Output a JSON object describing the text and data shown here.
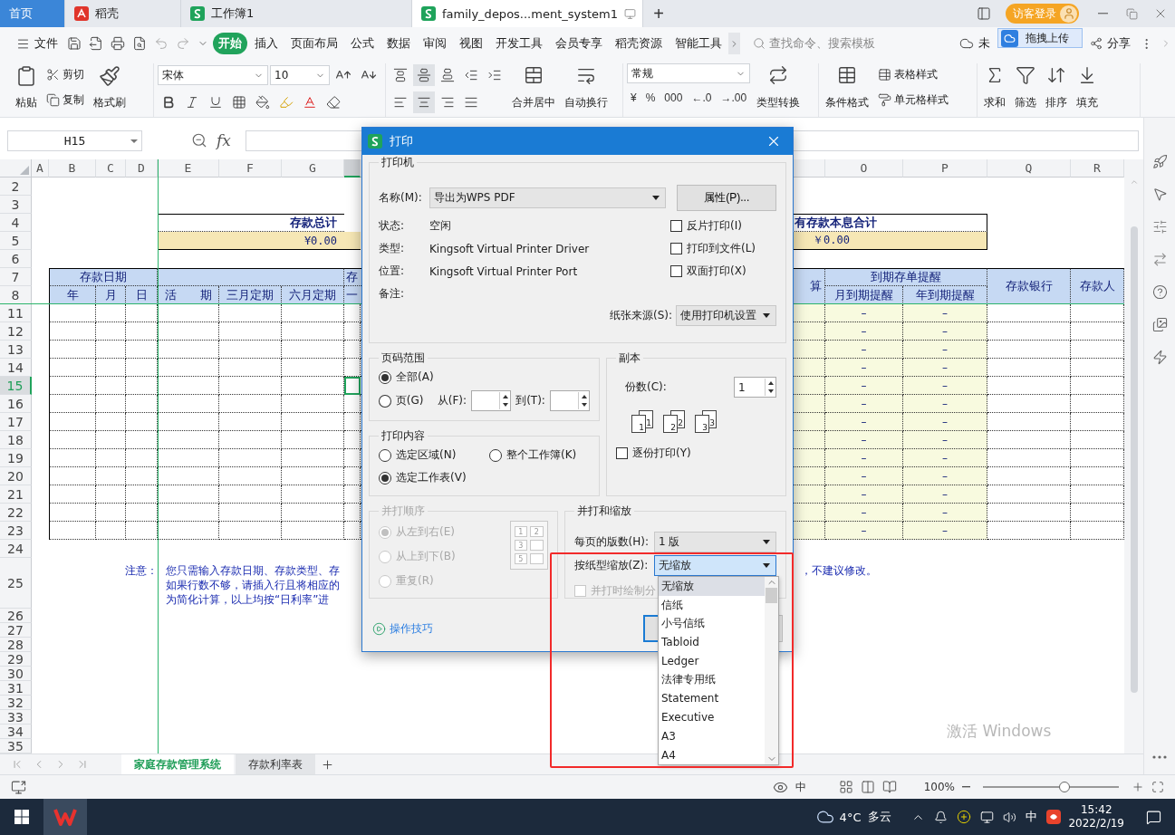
{
  "title_bar": {
    "tabs": [
      {
        "label": "首页",
        "selected": false,
        "kind": "home"
      },
      {
        "label": "稻壳",
        "selected": false,
        "kind": "docer"
      },
      {
        "label": "工作簿1",
        "selected": false,
        "kind": "sheet"
      },
      {
        "label": "family_depos...ment_system1",
        "selected": true,
        "kind": "sheet"
      }
    ],
    "new_tab": "+",
    "login": "访客登录"
  },
  "menu": {
    "file": "文件",
    "tabs": [
      {
        "label": "开始",
        "selected": true
      },
      {
        "label": "插入",
        "selected": false
      },
      {
        "label": "页面布局",
        "selected": false
      },
      {
        "label": "公式",
        "selected": false
      },
      {
        "label": "数据",
        "selected": false
      },
      {
        "label": "审阅",
        "selected": false
      },
      {
        "label": "视图",
        "selected": false
      },
      {
        "label": "开发工具",
        "selected": false
      },
      {
        "label": "会员专享",
        "selected": false
      },
      {
        "label": "稻壳资源",
        "selected": false
      },
      {
        "label": "智能工具",
        "selected": false
      }
    ],
    "search_placeholder": "查找命令、搜索模板",
    "sync": "未",
    "upload_tip": "拖拽上传",
    "share": "分享"
  },
  "ribbon": {
    "paste": "粘贴",
    "cut": "剪切",
    "copy": "复制",
    "painter": "格式刷",
    "font": "宋体",
    "size": "10",
    "merge": "合并居中",
    "wrap": "自动换行",
    "number_format": "常规",
    "number_buttons": [
      "¥",
      "%",
      "000",
      "←.0",
      "→.00"
    ],
    "convert": "类型转换",
    "conditional": "条件格式",
    "table_style": "表格样式",
    "cell_style": "单元格样式",
    "sum": "求和",
    "filter": "筛选",
    "sort": "排序",
    "fill": "填充"
  },
  "formula_bar": {
    "cell": "H15",
    "fx": "fx"
  },
  "sheet": {
    "columns": [
      {
        "label": "A",
        "selected": false
      },
      {
        "label": "B",
        "selected": false
      },
      {
        "label": "C",
        "selected": false
      },
      {
        "label": "D",
        "selected": false
      },
      {
        "label": "E",
        "selected": false
      },
      {
        "label": "F",
        "selected": false
      },
      {
        "label": "G",
        "selected": false
      },
      {
        "selected": true
      },
      {
        "selected": false
      },
      {
        "selected": false
      },
      {
        "label": "O",
        "selected": false
      },
      {
        "label": "P",
        "selected": false
      },
      {
        "label": "Q",
        "selected": false
      },
      {
        "label": "R",
        "selected": false
      }
    ],
    "row_headers": [
      {
        "label": "2",
        "selected": false
      },
      {
        "label": "3",
        "selected": false
      },
      {
        "label": "4",
        "selected": false
      },
      {
        "label": "5",
        "selected": false
      },
      {
        "label": "6",
        "selected": false
      },
      {
        "label": "7",
        "selected": false
      },
      {
        "label": "8",
        "selected": false
      },
      {
        "label": "11",
        "selected": false
      },
      {
        "label": "12",
        "selected": false
      },
      {
        "label": "13",
        "selected": false
      },
      {
        "label": "14",
        "selected": false
      },
      {
        "label": "15",
        "selected": true
      },
      {
        "label": "16",
        "selected": false
      },
      {
        "label": "17",
        "selected": false
      },
      {
        "label": "18",
        "selected": false
      },
      {
        "label": "19",
        "selected": false
      },
      {
        "label": "20",
        "selected": false
      },
      {
        "label": "21",
        "selected": false
      },
      {
        "label": "22",
        "selected": false
      },
      {
        "label": "23",
        "selected": false
      },
      {
        "label": "24",
        "selected": false
      },
      {
        "label": "25",
        "selected": false
      },
      {
        "label": "26",
        "selected": false
      },
      {
        "label": "27",
        "selected": false
      },
      {
        "label": "28",
        "selected": false
      },
      {
        "label": "29",
        "selected": false
      },
      {
        "label": "30",
        "selected": false
      },
      {
        "label": "31",
        "selected": false
      },
      {
        "label": "32",
        "selected": false
      },
      {
        "label": "33",
        "selected": false
      },
      {
        "label": "34",
        "selected": false
      },
      {
        "label": "35",
        "selected": false
      }
    ],
    "summary": [
      {
        "label": "存款总计",
        "value": "¥0.00"
      },
      {
        "label": "有存款本息合计",
        "value": "￥0.00"
      }
    ],
    "header": {
      "date_group": "存款日期",
      "date_cols": [
        "年",
        "月",
        "日"
      ],
      "type_cols": [
        "活　　期",
        "三月定期",
        "六月定期"
      ],
      "type_group_cut": "存",
      "type_cut": "一",
      "calc_cut": "算",
      "reminder_group": "到期存单提醒",
      "reminder_cols": [
        "月到期提醒",
        "年到期提醒"
      ],
      "bank": "存款银行",
      "depositor": "存款人"
    },
    "data_rows": [
      {
        "selected": false,
        "reminders": [
          "–",
          "–"
        ]
      },
      {
        "selected": false,
        "reminders": [
          "–",
          "–"
        ]
      },
      {
        "selected": false,
        "reminders": [
          "–",
          "–"
        ]
      },
      {
        "selected": false,
        "reminders": [
          "–",
          "–"
        ]
      },
      {
        "selected": true,
        "reminders": [
          "–",
          "–"
        ]
      },
      {
        "selected": false,
        "reminders": [
          "–",
          "–"
        ]
      },
      {
        "selected": false,
        "reminders": [
          "–",
          "–"
        ]
      },
      {
        "selected": false,
        "reminders": [
          "–",
          "–"
        ]
      },
      {
        "selected": false,
        "reminders": [
          "–",
          "–"
        ]
      },
      {
        "selected": false,
        "reminders": [
          "–",
          "–"
        ]
      },
      {
        "selected": false,
        "reminders": [
          "–",
          "–"
        ]
      },
      {
        "selected": false,
        "reminders": [
          "–",
          "–"
        ]
      },
      {
        "selected": false,
        "reminders": [
          "–",
          "–"
        ]
      }
    ],
    "note": {
      "label": "注意：",
      "lines": [
        "您只需输入存款日期、存款类型、存",
        "如果行数不够，请插入行且将相应的",
        "为简化计算，以上均按“日利率”进"
      ],
      "tail": "，不建议修改。"
    },
    "activation": "激活 Windows"
  },
  "sheet_tabs": [
    {
      "label": "家庭存款管理系统",
      "selected": true
    },
    {
      "label": "存款利率表",
      "selected": false
    }
  ],
  "status_bar": {
    "input_mode": "中",
    "zoom": "100%",
    "zoom_slider": {
      "level": 0.6
    }
  },
  "taskbar": {
    "temperature": "4°C",
    "weather": "多云",
    "ime": "中",
    "time": "15:42",
    "date": "2022/2/19"
  },
  "dialog": {
    "title": "打印",
    "printer": {
      "legend": "打印机",
      "name_label": "名称(M):",
      "name": "导出为WPS PDF",
      "properties": "属性(P)...",
      "info": [
        {
          "label": "状态:",
          "value": "空闲"
        },
        {
          "label": "类型:",
          "value": "Kingsoft Virtual Printer Driver"
        },
        {
          "label": "位置:",
          "value": "Kingsoft Virtual Printer Port"
        },
        {
          "label": "备注:"
        }
      ],
      "options": [
        {
          "label": "反片打印(I)",
          "checked": false
        },
        {
          "label": "打印到文件(L)",
          "checked": false
        },
        {
          "label": "双面打印(X)",
          "checked": false
        }
      ],
      "source_label": "纸张来源(S):",
      "source": "使用打印机设置"
    },
    "range": {
      "legend": "页码范围",
      "options": [
        {
          "label": "全部(A)",
          "selected": true
        },
        {
          "label": "页(G)",
          "selected": false
        }
      ],
      "from": "从(F):",
      "to": "到(T):"
    },
    "copies": {
      "legend": "副本",
      "label": "份数(C):",
      "value": "1",
      "sets": [
        [
          "1",
          "1"
        ],
        [
          "2",
          "2"
        ],
        [
          "3",
          "3"
        ]
      ],
      "collate": {
        "label": "逐份打印(Y)",
        "checked": false
      }
    },
    "content": {
      "legend": "打印内容",
      "options": [
        {
          "label": "选定区域(N)",
          "selected": false
        },
        {
          "label": "整个工作簿(K)",
          "selected": false
        },
        {
          "label": "选定工作表(V)",
          "selected": true
        }
      ]
    },
    "order": {
      "legend": "并打顺序",
      "disabled": true,
      "options": [
        {
          "label": "从左到右(E)",
          "selected": true
        },
        {
          "label": "从上到下(B)",
          "selected": false
        },
        {
          "label": "重复(R)",
          "selected": false
        }
      ],
      "grid": [
        [
          "1",
          "2"
        ],
        [
          "3"
        ],
        [
          "5"
        ]
      ]
    },
    "scale": {
      "legend": "并打和缩放",
      "per_page_label": "每页的版数(H):",
      "per_page": "1 版",
      "paper_label": "按纸型缩放(Z):",
      "paper": "无缩放",
      "divider": {
        "label": "并打时绘制分",
        "checked": false,
        "disabled": true
      }
    },
    "tips": "操作技巧",
    "paper_options": [
      {
        "label": "无缩放",
        "selected": true
      },
      {
        "label": "信纸",
        "selected": false
      },
      {
        "label": "小号信纸",
        "selected": false
      },
      {
        "label": "Tabloid",
        "selected": false
      },
      {
        "label": "Ledger",
        "selected": false
      },
      {
        "label": "法律专用纸",
        "selected": false
      },
      {
        "label": "Statement",
        "selected": false
      },
      {
        "label": "Executive",
        "selected": false
      },
      {
        "label": "A3",
        "selected": false
      },
      {
        "label": "A4",
        "selected": false
      }
    ]
  }
}
